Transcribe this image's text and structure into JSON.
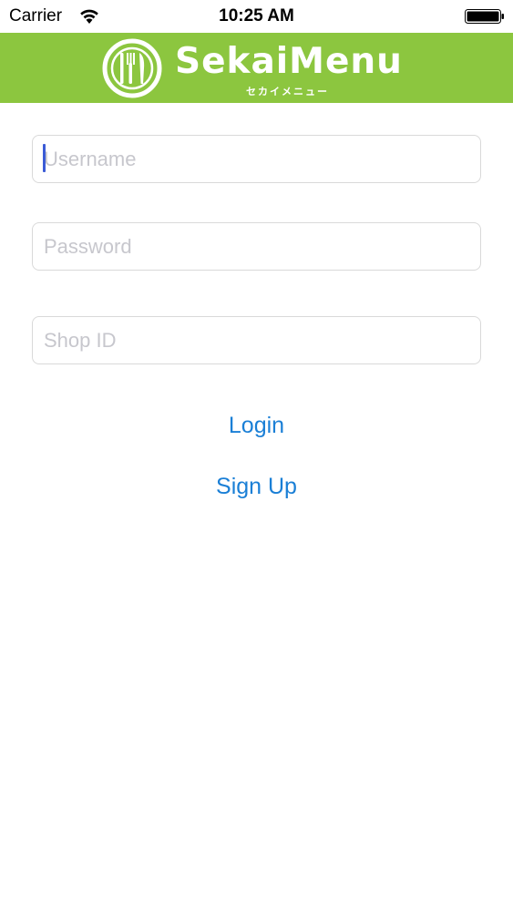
{
  "status_bar": {
    "carrier": "Carrier",
    "time": "10:25 AM"
  },
  "header": {
    "brand_name": "SekaiMenu",
    "brand_kana": "セカイメニュー",
    "background_color": "#8cc63f"
  },
  "form": {
    "username_placeholder": "Username",
    "password_placeholder": "Password",
    "shop_id_placeholder": "Shop ID"
  },
  "actions": {
    "login_label": "Login",
    "signup_label": "Sign Up",
    "link_color": "#1a7fd6"
  }
}
